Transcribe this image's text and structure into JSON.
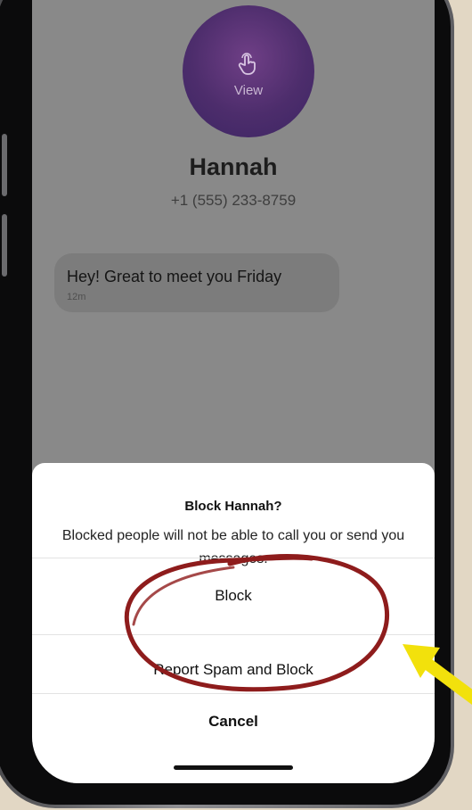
{
  "contact": {
    "photo_label": "View",
    "name": "Hannah",
    "phone": "+1 (555) 233-8759"
  },
  "conversation": {
    "messages": [
      {
        "text": "Hey! Great to meet you Friday",
        "time": "12m"
      }
    ]
  },
  "action_sheet": {
    "title": "Block Hannah?",
    "message": "Blocked people will not be able to call you or send you messages.",
    "block_label": "Block",
    "report_label": "Report Spam and Block",
    "cancel_label": "Cancel"
  },
  "annotation": {
    "circle_color": "#8e1c1c",
    "arrow_color": "#f2e10c"
  },
  "icons": {
    "contact_photo_icon": "hand-pointer-icon"
  }
}
